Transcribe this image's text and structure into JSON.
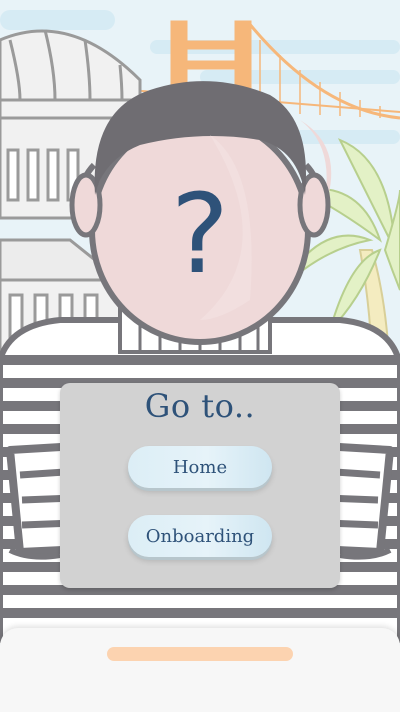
{
  "avatar": {
    "face_glyph": "?"
  },
  "sign": {
    "title": "Go to..",
    "home_label": "Home",
    "onboarding_label": "Onboarding"
  },
  "colors": {
    "accent": "#2e5279",
    "sky": "#e8f3f8",
    "handle": "#fcd3b0",
    "outline": "#77767b"
  }
}
